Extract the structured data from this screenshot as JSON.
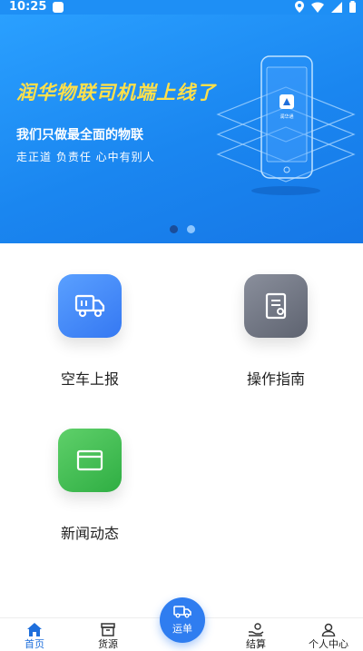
{
  "status_bar": {
    "time": "10:25"
  },
  "banner": {
    "title": "润华物联司机端上线了",
    "subtitle": "我们只做最全面的物联",
    "tagline": "走正道  负责任  心中有别人",
    "phone_badge": "润华通"
  },
  "grid": {
    "items": [
      {
        "label": "空车上报",
        "icon": "truck-icon"
      },
      {
        "label": "操作指南",
        "icon": "document-icon"
      },
      {
        "label": "新闻动态",
        "icon": "folder-icon"
      }
    ]
  },
  "tabbar": {
    "tabs": [
      {
        "label": "首页",
        "icon": "home-icon",
        "active": true
      },
      {
        "label": "货源",
        "icon": "box-icon"
      },
      {
        "label": "运单",
        "icon": "truck-icon"
      },
      {
        "label": "结算",
        "icon": "hand-coin-icon"
      },
      {
        "label": "个人中心",
        "icon": "user-icon"
      }
    ]
  },
  "colors": {
    "accent": "#1f6fdc",
    "banner": "#1e8ff5",
    "title_yellow": "#ffe04a"
  }
}
